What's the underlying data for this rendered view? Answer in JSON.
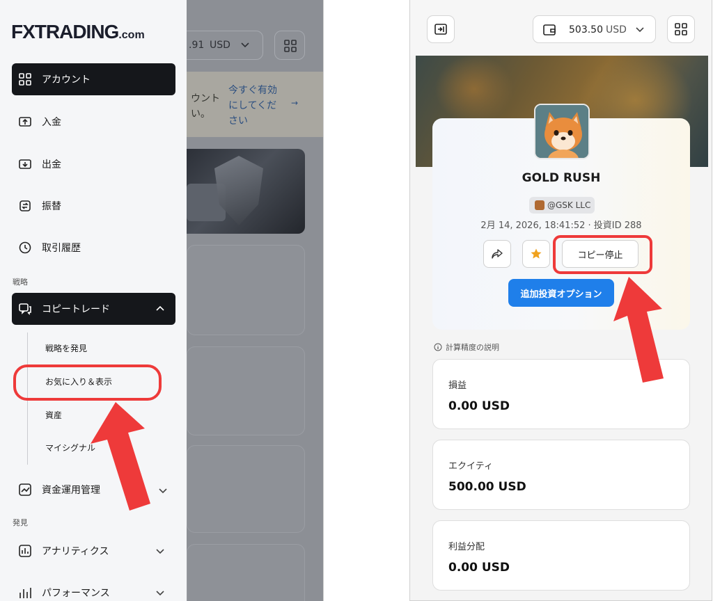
{
  "left_panel": {
    "logo": {
      "main": "FXTRADING",
      "suffix": ".com"
    },
    "nav": [
      {
        "label": "アカウント",
        "icon": "grid-icon",
        "active": true
      },
      {
        "label": "入金",
        "icon": "deposit-icon"
      },
      {
        "label": "出金",
        "icon": "withdraw-icon"
      },
      {
        "label": "振替",
        "icon": "transfer-icon"
      },
      {
        "label": "取引履歴",
        "icon": "history-icon"
      }
    ],
    "section_strategy": "戦略",
    "copytrade": {
      "label": "コピートレード",
      "icon": "chat-icon",
      "active": true,
      "expanded": true
    },
    "copytrade_sub": [
      "戦略を発見",
      "お気に入り＆表示",
      "資産",
      "マイシグナル"
    ],
    "asset_mgmt": {
      "label": "資金運用管理",
      "icon": "trend-icon"
    },
    "section_discover": "発見",
    "analytics": {
      "label": "アナリティクス",
      "icon": "bar-chart-icon"
    },
    "performance": {
      "label": "パフォーマンス",
      "icon": "performance-icon"
    },
    "background": {
      "balance_fragment": ".91",
      "currency": "USD",
      "notice_text": "ウント\nい。",
      "notice_link": "今すぐ有効にしてください",
      "notice_arrow": "→"
    }
  },
  "right_panel": {
    "wallet": {
      "amount": "503.50",
      "currency": "USD"
    },
    "profile": {
      "name": "GOLD RUSH",
      "handle": "@GSK LLC",
      "meta": "2月 14, 2026, 18:41:52 · 投資ID 288"
    },
    "actions": {
      "copy_stop": "コピー停止",
      "add_investment": "追加投資オプション"
    },
    "calc_note": "計算精度の説明",
    "stats": [
      {
        "label": "損益",
        "value": "0.00 USD"
      },
      {
        "label": "エクイティ",
        "value": "500.00 USD"
      },
      {
        "label": "利益分配",
        "value": "0.00 USD"
      }
    ]
  },
  "colors": {
    "accent_blue": "#1f7fea",
    "highlight_red": "#ee3a3a",
    "active_dark": "#15171b",
    "star_orange": "#f0a21e"
  }
}
